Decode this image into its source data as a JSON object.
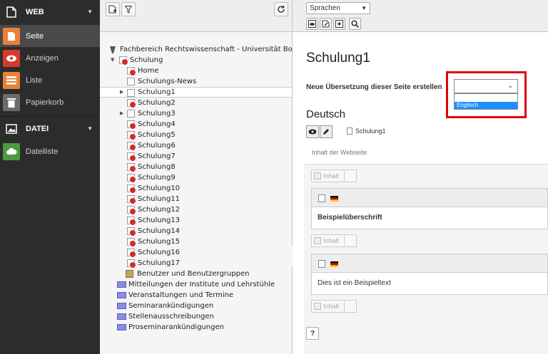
{
  "module_menu": {
    "groups": [
      {
        "label": "WEB",
        "items": [
          "Seite",
          "Anzeigen",
          "Liste",
          "Papierkorb"
        ]
      },
      {
        "label": "DATEI",
        "items": [
          "Dateiliste"
        ]
      }
    ],
    "colors": {
      "seite": "#e8813a",
      "anzeigen": "#d9392d",
      "liste": "#e8813a",
      "papierkorb": "#6b6b6b",
      "dateiliste": "#4b9a3d"
    }
  },
  "tree": {
    "root": "Fachbereich Rechtswissenschaft - Universität Bonn",
    "schulung": "Schulung",
    "children": [
      "Home",
      "Schulungs-News",
      "Schulung1",
      "Schulung2",
      "Schulung3",
      "Schulung4",
      "Schulung5",
      "Schulung6",
      "Schulung7",
      "Schulung8",
      "Schulung9",
      "Schulung10",
      "Schulung11",
      "Schulung12",
      "Schulung13",
      "Schulung14",
      "Schulung15",
      "Schulung16",
      "Schulung17"
    ],
    "users": "Benutzer und Benutzergruppen",
    "folders": [
      "Mitteilungen der Institute und Lehrstühle",
      "Veranstaltungen und Termine",
      "Seminarankündigungen",
      "Stellenausschreibungen",
      "Proseminarankündigungen"
    ]
  },
  "main": {
    "language_select": "Sprachen",
    "page_title": "Schulung1",
    "new_translation_label": "Neue Übersetzung dieser Seite erstellen",
    "dropdown_option": "Englisch",
    "language_heading": "Deutsch",
    "page_label": "Schulung1",
    "column_header": "Inhalt der Webseite",
    "inhalt_button": "Inhalt",
    "content_elements": [
      {
        "text": "Beispielüberschrift",
        "bold": true
      },
      {
        "text": "Dies ist ein Beispieltext",
        "bold": false
      }
    ],
    "help_label": "?"
  }
}
